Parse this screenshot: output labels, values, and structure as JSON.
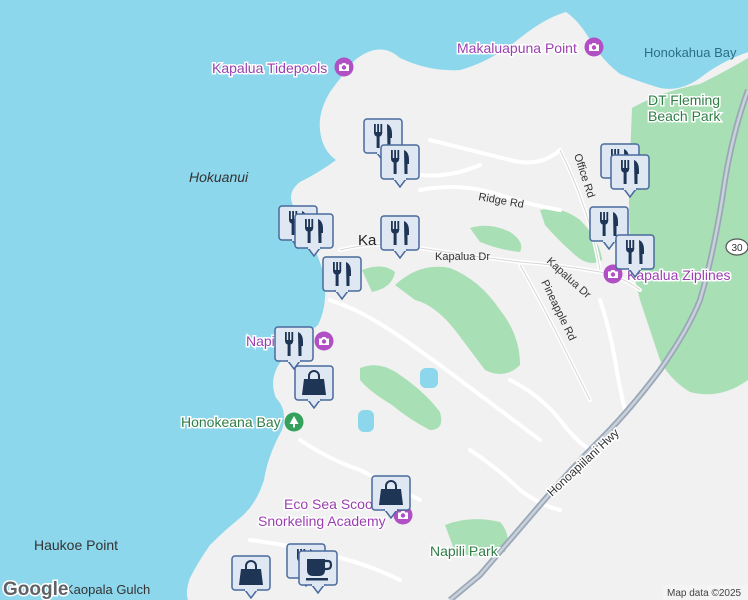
{
  "places": {
    "makaluapuna_point": "Makaluapuna Point",
    "honokahua_bay": "Honokahua Bay",
    "kapalua_tidepools": "Kapalua Tidepools",
    "dt_fleming_line1": "DT Fleming",
    "dt_fleming_line2": "Beach Park",
    "hokuanui": "Hokuanui",
    "ridge_rd": "Ridge Rd",
    "office_rd": "Office Rd",
    "kapalua_dr_1": "Kapalua Dr",
    "kapalua_dr_2": "Kapalua Dr",
    "kapalua_town": "Ka",
    "pineapple_rd": "Pineapple Rd",
    "kapalua_ziplines": "Kapalua Ziplines",
    "route_30": "30",
    "napili": "Napili",
    "honokeana_bay": "Honokeana Bay",
    "honoapiilani_hwy": "Honoapiilani Hwy",
    "eco_sea_line1": "Eco Sea Scoot",
    "eco_sea_line2": "Snorkeling Academy",
    "haukoe_point": "Haukoe Point",
    "napili_park": "Napili Park",
    "kaopala_gulch": "Kaopala Gulch"
  },
  "attribution": {
    "logo": "Google",
    "map_data": "Map data ©2025"
  },
  "colors": {
    "water": "#8dd7ec",
    "land": "#f1f1f1",
    "park": "#a8dfb5",
    "road": "#ffffff",
    "highway": "#9aa7b6",
    "poi_purple": "#b14fc5",
    "poi_green": "#35a25b",
    "marker_fill": "#dfe7f3",
    "marker_border": "#486a9c",
    "marker_icon": "#1e3556"
  },
  "markers": [
    {
      "type": "restaurant",
      "icon": "fork-knife-icon"
    },
    {
      "type": "restaurant",
      "icon": "fork-knife-icon"
    },
    {
      "type": "restaurant",
      "icon": "fork-knife-icon"
    },
    {
      "type": "restaurant",
      "icon": "fork-knife-icon"
    },
    {
      "type": "restaurant",
      "icon": "fork-knife-icon"
    },
    {
      "type": "restaurant",
      "icon": "fork-knife-icon"
    },
    {
      "type": "restaurant",
      "icon": "fork-knife-icon"
    },
    {
      "type": "restaurant",
      "icon": "fork-knife-icon"
    },
    {
      "type": "restaurant",
      "icon": "fork-knife-icon"
    },
    {
      "type": "restaurant",
      "icon": "fork-knife-icon"
    },
    {
      "type": "restaurant",
      "icon": "fork-knife-icon"
    },
    {
      "type": "shopping",
      "icon": "shopping-bag-icon"
    },
    {
      "type": "shopping",
      "icon": "shopping-bag-icon"
    },
    {
      "type": "shopping",
      "icon": "shopping-bag-icon"
    },
    {
      "type": "restaurant",
      "icon": "fork-knife-icon"
    },
    {
      "type": "cafe",
      "icon": "coffee-cup-icon"
    }
  ]
}
